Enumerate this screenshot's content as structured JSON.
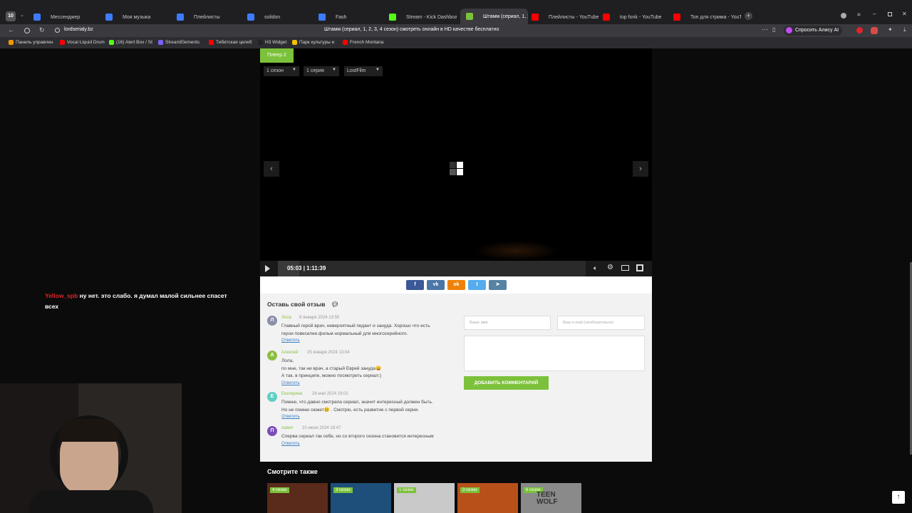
{
  "browser": {
    "tab_counter": "10",
    "tabs": [
      {
        "label": "Мессенджер",
        "color": "#3d7bff"
      },
      {
        "label": "Моя музыка",
        "color": "#3d7bff"
      },
      {
        "label": "Плейлисты",
        "color": "#3d7bff"
      },
      {
        "label": "solidon",
        "color": "#3d7bff"
      },
      {
        "label": "Fash",
        "color": "#3d7bff"
      },
      {
        "label": "Stream - Kick Dashboard",
        "color": "#53fc18"
      },
      {
        "label": "Штамм (сериал, 1, 2, 3",
        "color": "#7cc13b"
      },
      {
        "label": "Плейлисты - YouTube",
        "color": "#ff0000"
      },
      {
        "label": "top fonk - YouTube",
        "color": "#ff0000"
      },
      {
        "label": "Топ для стрима - YouTub",
        "color": "#ff0000"
      }
    ],
    "url": "lordserialy.bz",
    "page_title": "Штамм (сериал, 1, 2, 3, 4 сезон) смотреть онлайн в HD качестве бесплатно",
    "alice_label": "Спросить Алису AI",
    "bookmarks": [
      {
        "label": "Панель управлен",
        "color": "#f29900"
      },
      {
        "label": "Vocal Liquid Drum",
        "color": "#ff0000"
      },
      {
        "label": "(16) Alert Box / St",
        "color": "#53fc18"
      },
      {
        "label": "StreamElements",
        "color": "#7b61ff"
      },
      {
        "label": "Тибетская целеб",
        "color": "#ff0000"
      },
      {
        "label": "H3 Widget",
        "color": "#222222"
      },
      {
        "label": "Парк культуры и",
        "color": "#f2c200"
      },
      {
        "label": "French Montana",
        "color": "#ff0000"
      }
    ]
  },
  "player": {
    "tab_label": "Плеер 2",
    "season": "1 сезон",
    "episode": "1 серия",
    "voice": "LostFilm",
    "time_current": "05:03",
    "time_total": "1:11:39",
    "progress": 0.07
  },
  "share": [
    "f",
    "vk",
    "ok",
    "tw",
    "tg"
  ],
  "comments": {
    "title": "Оставь свой отзыв",
    "reply_label": "Ответить",
    "items": [
      {
        "initial": "Л",
        "color": "#8b8fa8",
        "name": "Лола",
        "date": "8 января 2024 13:55",
        "lines": [
          "Главный герой врач, невероятный педант и зануда. Хорошо что есть",
          "герои повеселее.фильм нормальный для многосерийного."
        ]
      },
      {
        "initial": "А",
        "color": "#8bbf43",
        "name": "Алексей",
        "date": "25 января 2024 13:04",
        "lines": [
          "Лола,",
          "по мне, так ни врач, а старый Еврей зануда😄",
          "А так, в принципе, можно посмотреть сериал:)"
        ]
      },
      {
        "initial": "Е",
        "color": "#5fcfc4",
        "name": "Екатерина",
        "date": "28 мая 2024 19:01",
        "lines": [
          "Помню, что давно смотрела сериал, значит интересный должен быть.",
          "Но не помню сюжет😢 . Смотрю, есть развитие с первой серии."
        ]
      },
      {
        "initial": "П",
        "color": "#7b4fb8",
        "name": "павел",
        "date": "10 июня 2024 18:47",
        "lines": [
          "Сперва сериал так себе, но со второго сезона становится интересным"
        ]
      }
    ],
    "form": {
      "name_placeholder": "Ваше имя",
      "email_placeholder": "Ваш e-mail (необязательно)",
      "submit_label": "ДОБАВИТЬ КОММЕНТАРИЙ"
    }
  },
  "similar": {
    "title": "Смотрите также",
    "items": [
      {
        "badge": "4 сезон",
        "color": "#5a2a1a"
      },
      {
        "badge": "3 сезон",
        "color": "#1d4f7a"
      },
      {
        "badge": "1 сезон",
        "color": "#c9c9c9"
      },
      {
        "badge": "3 сезон",
        "color": "#b8501a"
      },
      {
        "badge": "6 сезон",
        "color": "#8a8a8a",
        "overlay": "TEEN WOLF"
      }
    ]
  },
  "chat": {
    "user": "Yellow_spb",
    "user_color": "#e0242a",
    "message": "ну нет. это слабо. я думал малой сильнее спасет всех"
  }
}
